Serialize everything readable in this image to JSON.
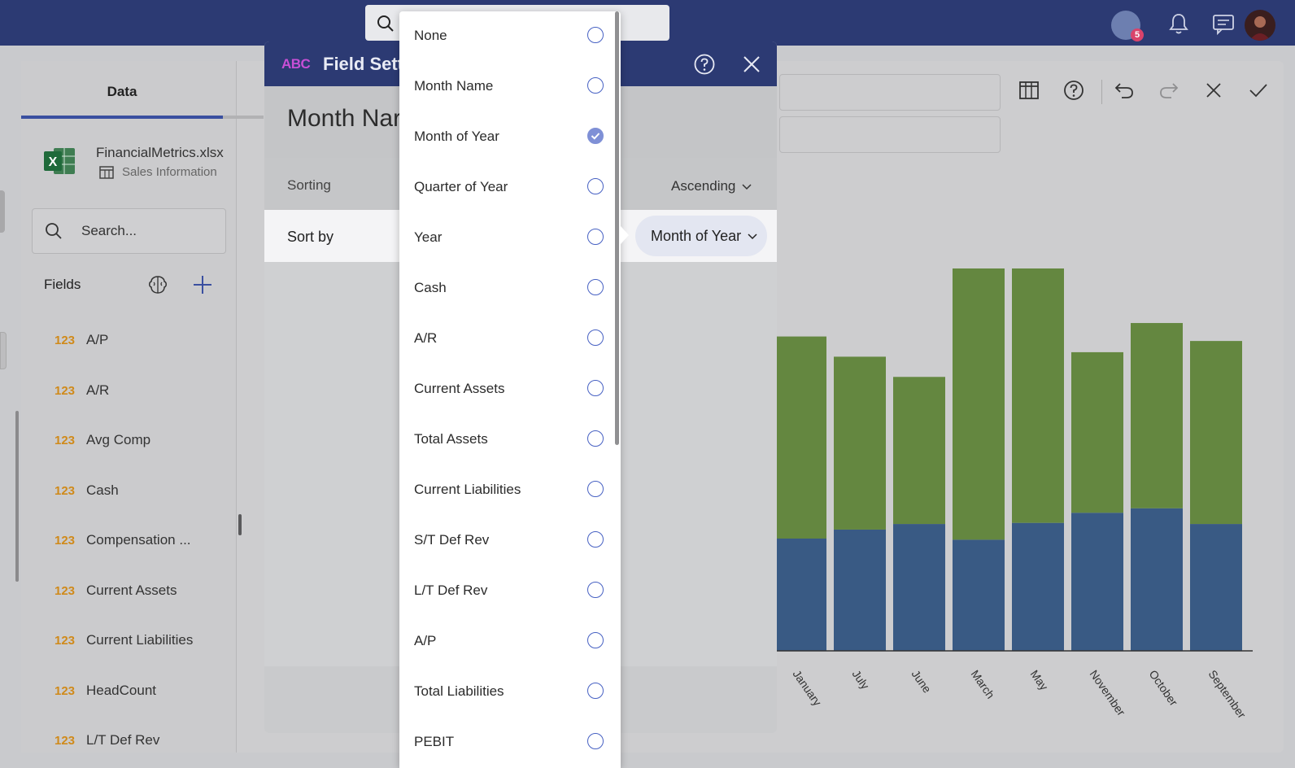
{
  "colors": {
    "topbar": "#2c3a73",
    "accent": "#3a4fa0",
    "bar_bottom": "#395a84",
    "bar_top": "#648740",
    "field_type": "#d08a1a"
  },
  "top": {
    "avatar_badge": "5"
  },
  "left_panel": {
    "tab": "Data",
    "file": {
      "name": "FinancialMetrics.xlsx",
      "sheet": "Sales Information"
    },
    "search_placeholder": "Search...",
    "fields_label": "Fields",
    "fields": [
      {
        "type": "123",
        "label": "A/P"
      },
      {
        "type": "123",
        "label": "A/R"
      },
      {
        "type": "123",
        "label": "Avg Comp"
      },
      {
        "type": "123",
        "label": "Cash"
      },
      {
        "type": "123",
        "label": "Compensation ..."
      },
      {
        "type": "123",
        "label": "Current Assets"
      },
      {
        "type": "123",
        "label": "Current Liabilities"
      },
      {
        "type": "123",
        "label": "HeadCount"
      },
      {
        "type": "123",
        "label": "L/T Def Rev"
      }
    ]
  },
  "dialog": {
    "type_badge": "ABC",
    "title": "Field Setti",
    "field_title": "Month Nar",
    "sorting_label": "Sorting",
    "sorting_value": "Ascending",
    "sortby_label": "Sort by",
    "sortby_value": "Month of Year"
  },
  "dropdown": {
    "options": [
      {
        "label": "None",
        "checked": false
      },
      {
        "label": "Month Name",
        "checked": false
      },
      {
        "label": "Month of Year",
        "checked": true
      },
      {
        "label": "Quarter of Year",
        "checked": false
      },
      {
        "label": "Year",
        "checked": false
      },
      {
        "label": "Cash",
        "checked": false
      },
      {
        "label": "A/R",
        "checked": false
      },
      {
        "label": "Current Assets",
        "checked": false
      },
      {
        "label": "Total Assets",
        "checked": false
      },
      {
        "label": "Current Liabilities",
        "checked": false
      },
      {
        "label": "S/T Def Rev",
        "checked": false
      },
      {
        "label": "L/T Def Rev",
        "checked": false
      },
      {
        "label": "A/P",
        "checked": false
      },
      {
        "label": "Total Liabilities",
        "checked": false
      },
      {
        "label": "PEBIT",
        "checked": false
      }
    ]
  },
  "chart_data": {
    "type": "bar",
    "stacked": true,
    "categories": [
      "January",
      "July",
      "June",
      "March",
      "May",
      "November",
      "October",
      "September"
    ],
    "series": [
      {
        "values": [
          100,
          108,
          113,
          99,
          114,
          123,
          127,
          113
        ]
      },
      {
        "values": [
          180,
          154,
          131,
          254,
          229,
          143,
          165,
          163
        ]
      }
    ]
  }
}
